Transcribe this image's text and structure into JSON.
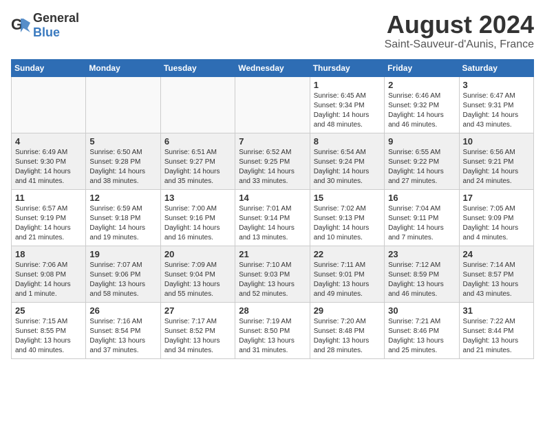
{
  "header": {
    "logo_general": "General",
    "logo_blue": "Blue",
    "month_year": "August 2024",
    "location": "Saint-Sauveur-d'Aunis, France"
  },
  "days_of_week": [
    "Sunday",
    "Monday",
    "Tuesday",
    "Wednesday",
    "Thursday",
    "Friday",
    "Saturday"
  ],
  "weeks": [
    [
      {
        "day": "",
        "info": "",
        "empty": true
      },
      {
        "day": "",
        "info": "",
        "empty": true
      },
      {
        "day": "",
        "info": "",
        "empty": true
      },
      {
        "day": "",
        "info": "",
        "empty": true
      },
      {
        "day": "1",
        "info": "Sunrise: 6:45 AM\nSunset: 9:34 PM\nDaylight: 14 hours\nand 48 minutes."
      },
      {
        "day": "2",
        "info": "Sunrise: 6:46 AM\nSunset: 9:32 PM\nDaylight: 14 hours\nand 46 minutes."
      },
      {
        "day": "3",
        "info": "Sunrise: 6:47 AM\nSunset: 9:31 PM\nDaylight: 14 hours\nand 43 minutes."
      }
    ],
    [
      {
        "day": "4",
        "info": "Sunrise: 6:49 AM\nSunset: 9:30 PM\nDaylight: 14 hours\nand 41 minutes.",
        "shaded": true
      },
      {
        "day": "5",
        "info": "Sunrise: 6:50 AM\nSunset: 9:28 PM\nDaylight: 14 hours\nand 38 minutes.",
        "shaded": true
      },
      {
        "day": "6",
        "info": "Sunrise: 6:51 AM\nSunset: 9:27 PM\nDaylight: 14 hours\nand 35 minutes.",
        "shaded": true
      },
      {
        "day": "7",
        "info": "Sunrise: 6:52 AM\nSunset: 9:25 PM\nDaylight: 14 hours\nand 33 minutes.",
        "shaded": true
      },
      {
        "day": "8",
        "info": "Sunrise: 6:54 AM\nSunset: 9:24 PM\nDaylight: 14 hours\nand 30 minutes.",
        "shaded": true
      },
      {
        "day": "9",
        "info": "Sunrise: 6:55 AM\nSunset: 9:22 PM\nDaylight: 14 hours\nand 27 minutes.",
        "shaded": true
      },
      {
        "day": "10",
        "info": "Sunrise: 6:56 AM\nSunset: 9:21 PM\nDaylight: 14 hours\nand 24 minutes.",
        "shaded": true
      }
    ],
    [
      {
        "day": "11",
        "info": "Sunrise: 6:57 AM\nSunset: 9:19 PM\nDaylight: 14 hours\nand 21 minutes."
      },
      {
        "day": "12",
        "info": "Sunrise: 6:59 AM\nSunset: 9:18 PM\nDaylight: 14 hours\nand 19 minutes."
      },
      {
        "day": "13",
        "info": "Sunrise: 7:00 AM\nSunset: 9:16 PM\nDaylight: 14 hours\nand 16 minutes."
      },
      {
        "day": "14",
        "info": "Sunrise: 7:01 AM\nSunset: 9:14 PM\nDaylight: 14 hours\nand 13 minutes."
      },
      {
        "day": "15",
        "info": "Sunrise: 7:02 AM\nSunset: 9:13 PM\nDaylight: 14 hours\nand 10 minutes."
      },
      {
        "day": "16",
        "info": "Sunrise: 7:04 AM\nSunset: 9:11 PM\nDaylight: 14 hours\nand 7 minutes."
      },
      {
        "day": "17",
        "info": "Sunrise: 7:05 AM\nSunset: 9:09 PM\nDaylight: 14 hours\nand 4 minutes."
      }
    ],
    [
      {
        "day": "18",
        "info": "Sunrise: 7:06 AM\nSunset: 9:08 PM\nDaylight: 14 hours\nand 1 minute.",
        "shaded": true
      },
      {
        "day": "19",
        "info": "Sunrise: 7:07 AM\nSunset: 9:06 PM\nDaylight: 13 hours\nand 58 minutes.",
        "shaded": true
      },
      {
        "day": "20",
        "info": "Sunrise: 7:09 AM\nSunset: 9:04 PM\nDaylight: 13 hours\nand 55 minutes.",
        "shaded": true
      },
      {
        "day": "21",
        "info": "Sunrise: 7:10 AM\nSunset: 9:03 PM\nDaylight: 13 hours\nand 52 minutes.",
        "shaded": true
      },
      {
        "day": "22",
        "info": "Sunrise: 7:11 AM\nSunset: 9:01 PM\nDaylight: 13 hours\nand 49 minutes.",
        "shaded": true
      },
      {
        "day": "23",
        "info": "Sunrise: 7:12 AM\nSunset: 8:59 PM\nDaylight: 13 hours\nand 46 minutes.",
        "shaded": true
      },
      {
        "day": "24",
        "info": "Sunrise: 7:14 AM\nSunset: 8:57 PM\nDaylight: 13 hours\nand 43 minutes.",
        "shaded": true
      }
    ],
    [
      {
        "day": "25",
        "info": "Sunrise: 7:15 AM\nSunset: 8:55 PM\nDaylight: 13 hours\nand 40 minutes."
      },
      {
        "day": "26",
        "info": "Sunrise: 7:16 AM\nSunset: 8:54 PM\nDaylight: 13 hours\nand 37 minutes."
      },
      {
        "day": "27",
        "info": "Sunrise: 7:17 AM\nSunset: 8:52 PM\nDaylight: 13 hours\nand 34 minutes."
      },
      {
        "day": "28",
        "info": "Sunrise: 7:19 AM\nSunset: 8:50 PM\nDaylight: 13 hours\nand 31 minutes."
      },
      {
        "day": "29",
        "info": "Sunrise: 7:20 AM\nSunset: 8:48 PM\nDaylight: 13 hours\nand 28 minutes."
      },
      {
        "day": "30",
        "info": "Sunrise: 7:21 AM\nSunset: 8:46 PM\nDaylight: 13 hours\nand 25 minutes."
      },
      {
        "day": "31",
        "info": "Sunrise: 7:22 AM\nSunset: 8:44 PM\nDaylight: 13 hours\nand 21 minutes."
      }
    ]
  ]
}
